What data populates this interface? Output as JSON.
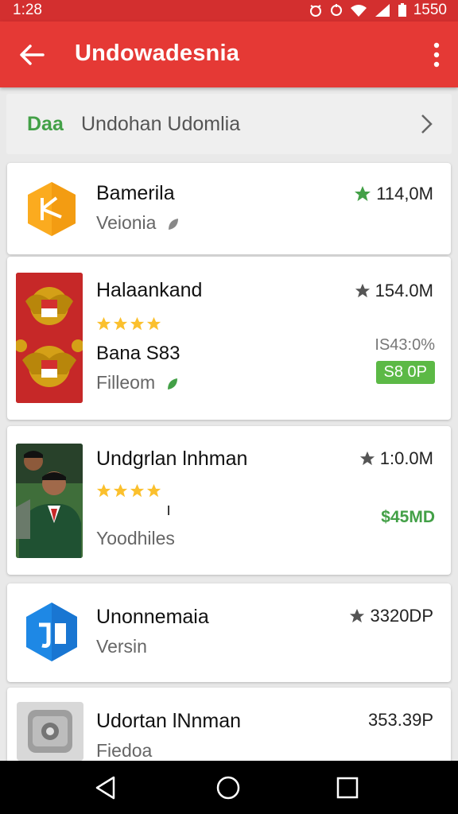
{
  "status": {
    "time": "1:28",
    "battery": "1550"
  },
  "appbar": {
    "title": "Undowadesnia",
    "back_icon": "arrow-left-icon",
    "menu_icon": "more-vert-icon"
  },
  "category": {
    "tag": "Daa",
    "label": "Undohan Udomlia",
    "chevron_icon": "chevron-right-icon"
  },
  "apps": [
    {
      "name": "Bamerila",
      "subtitle": "Veionia",
      "stat": "114,0M",
      "star_color": "#43a047"
    },
    {
      "name": "Halaankand",
      "subtitle": "Filleom",
      "stat": "154.0M",
      "rating_stars": 4,
      "meta": "Bana S83",
      "old_price": "IS43:0%",
      "price": "S8 0P"
    },
    {
      "name": "Undgrlan lnhman",
      "subtitle": "Yoodhiles",
      "stat": "1:0.0M",
      "rating_stars": 4,
      "tick": "ı",
      "price": "$45MD"
    },
    {
      "name": "Unonnemaia",
      "subtitle": "Versin",
      "stat": "3320DP"
    },
    {
      "name": "Udortan lNnman",
      "subtitle": "Fiedoa",
      "stat": "353.39P"
    }
  ],
  "colors": {
    "primary": "#e53935",
    "status_bar": "#d32f2f",
    "accent_green": "#43a047",
    "star_yellow": "#fbc02d"
  },
  "nav": {
    "back_icon": "nav-back-icon",
    "home_icon": "nav-home-icon",
    "recents_icon": "nav-recents-icon"
  }
}
